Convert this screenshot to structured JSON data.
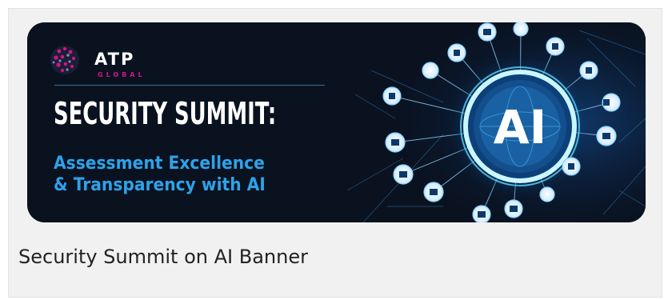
{
  "banner": {
    "logo": {
      "name": "ATP",
      "sub": "GLOBAL"
    },
    "title": "SECURITY SUMMIT:",
    "subtitle_line1": "Assessment Excellence",
    "subtitle_line2": "& Transparency with AI",
    "ai_text": "AI",
    "colors": {
      "accent": "#2ea2e8",
      "brand_magenta": "#d4148c",
      "background": "#0a1220"
    }
  },
  "caption": "Security Summit on AI Banner"
}
